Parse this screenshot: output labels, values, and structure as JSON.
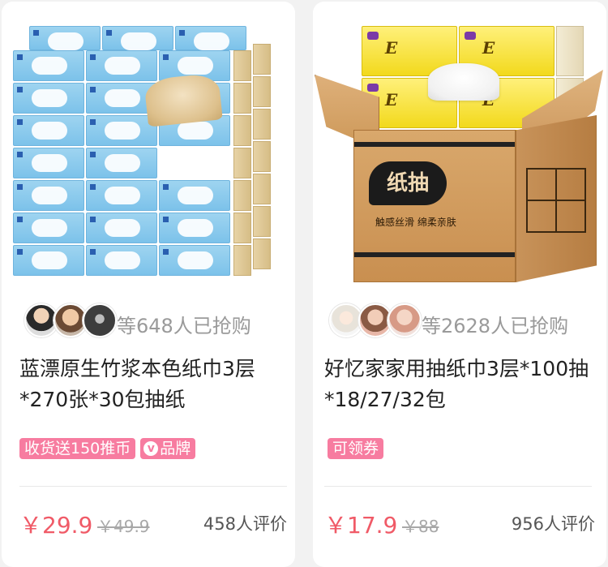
{
  "products": [
    {
      "buyers_text": "等648人已抢购",
      "title": "蓝漂原生竹浆本色纸巾3层*270张*30包抽纸",
      "tags": [
        "收货送150推币",
        "品牌"
      ],
      "price": "￥29.9",
      "original_price": "￥49.9",
      "reviews": "458人评价"
    },
    {
      "buyers_text": "等2628人已抢购",
      "title": "好忆家家用抽纸巾3层*100抽*18/27/32包",
      "tags": [
        "可领券"
      ],
      "box_label": "纸抽",
      "box_slogan": "触感丝滑 绵柔亲肤",
      "price": "￥17.9",
      "original_price": "￥88",
      "reviews": "956人评价"
    }
  ],
  "colors": {
    "price": "#f05a67",
    "tag_bg": "#f77ca0",
    "muted_text": "#9a9a9a",
    "page_bg": "#f2f2f2"
  },
  "icons": [
    "avatar",
    "v-brand-icon",
    "tissue-product-image"
  ]
}
